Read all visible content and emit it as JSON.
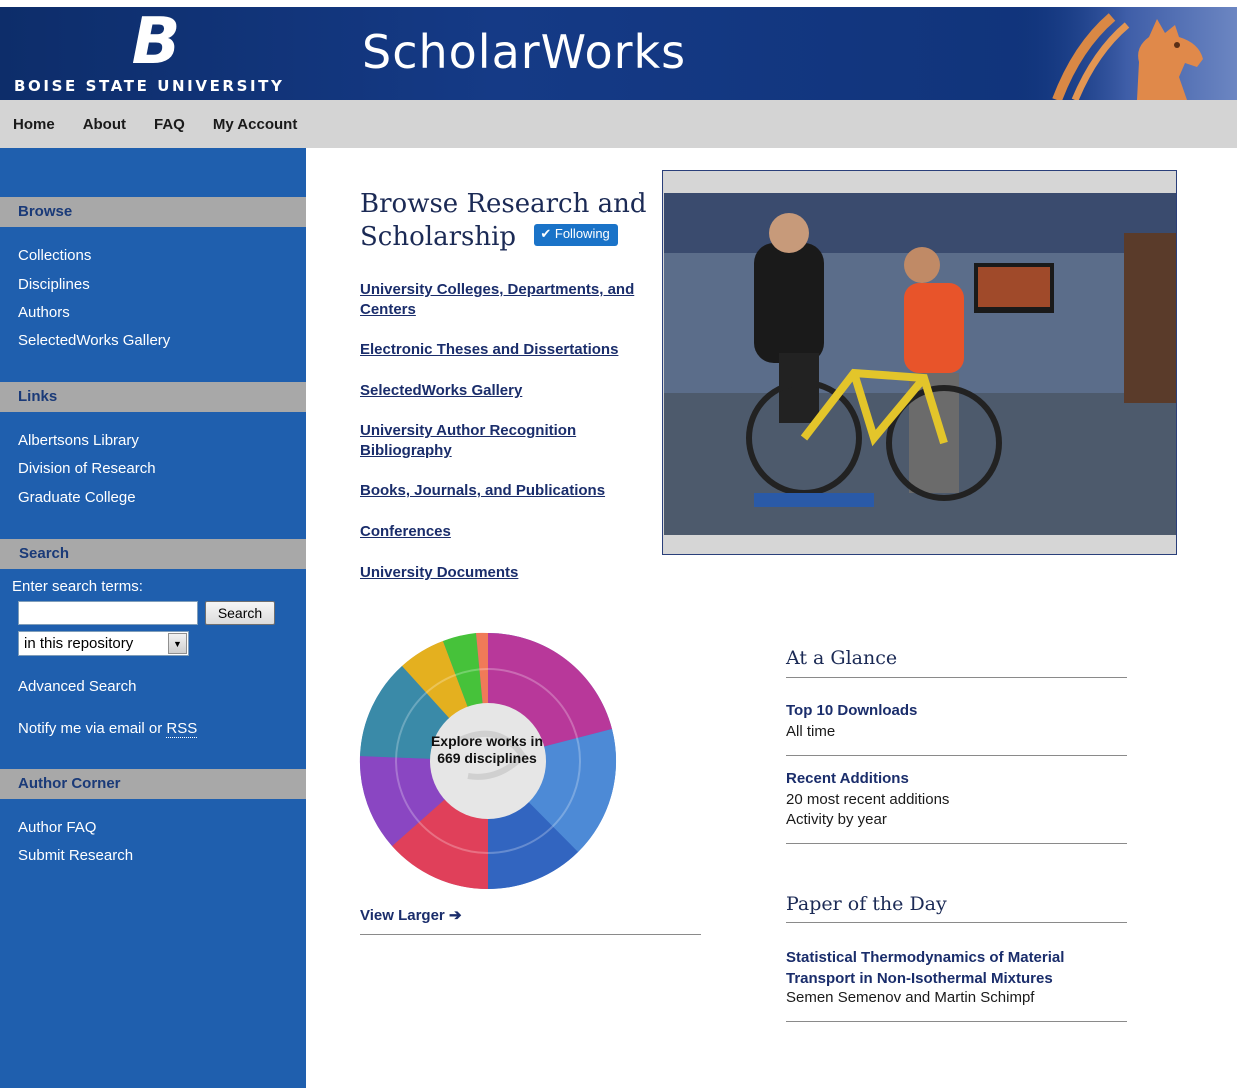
{
  "header": {
    "logo_letter": "B",
    "university": "BOISE STATE UNIVERSITY",
    "site_title": "ScholarWorks"
  },
  "topnav": [
    {
      "label": "Home"
    },
    {
      "label": "About"
    },
    {
      "label": "FAQ"
    },
    {
      "label": "My Account"
    }
  ],
  "sidebar": {
    "browse": {
      "heading": "Browse",
      "items": [
        "Collections",
        "Disciplines",
        "Authors",
        "SelectedWorks Gallery"
      ]
    },
    "links": {
      "heading": "Links",
      "items": [
        "Albertsons Library",
        "Division of Research",
        "Graduate College"
      ]
    },
    "search": {
      "heading": "Search",
      "label": "Enter search terms:",
      "input_value": "",
      "button": "Search",
      "scope_selected": "in this repository",
      "advanced": "Advanced Search",
      "notify_prefix": "Notify me via email or ",
      "notify_rss": "RSS"
    },
    "author_corner": {
      "heading": "Author Corner",
      "items": [
        "Author FAQ",
        "Submit Research"
      ]
    }
  },
  "main": {
    "browse_title": "Browse Research and Scholarship",
    "following": "Following",
    "links": [
      "University Colleges, Departments, and Centers",
      "Electronic Theses and Dissertations",
      "SelectedWorks Gallery",
      "University Author Recognition Bibliography",
      "Books, Journals, and Publications",
      "Conferences",
      "University Documents"
    ],
    "sunburst_label": "Explore works in 669 disciplines",
    "view_larger": "View Larger"
  },
  "glance": {
    "title": "At a Glance",
    "top_downloads": "Top 10 Downloads",
    "top_downloads_sub": "All time",
    "recent": "Recent Additions",
    "recent_sub1": "20 most recent additions",
    "recent_sub2": "Activity by year"
  },
  "paper": {
    "title": "Paper of the Day",
    "paper_title": "Statistical Thermodynamics of Material Transport in Non-Isothermal Mixtures",
    "authors": "Semen Semenov and Martin Schimpf"
  },
  "colors": {
    "header_blue": "#153a86",
    "sidebar_blue": "#1f5fae",
    "nav_gray": "#d4d4d4",
    "link_navy": "#1a2d6b",
    "following_blue": "#1a73c8"
  },
  "icons": {
    "following": "check-icon",
    "view_larger": "arrow-right-icon",
    "select": "chevron-down-icon"
  }
}
